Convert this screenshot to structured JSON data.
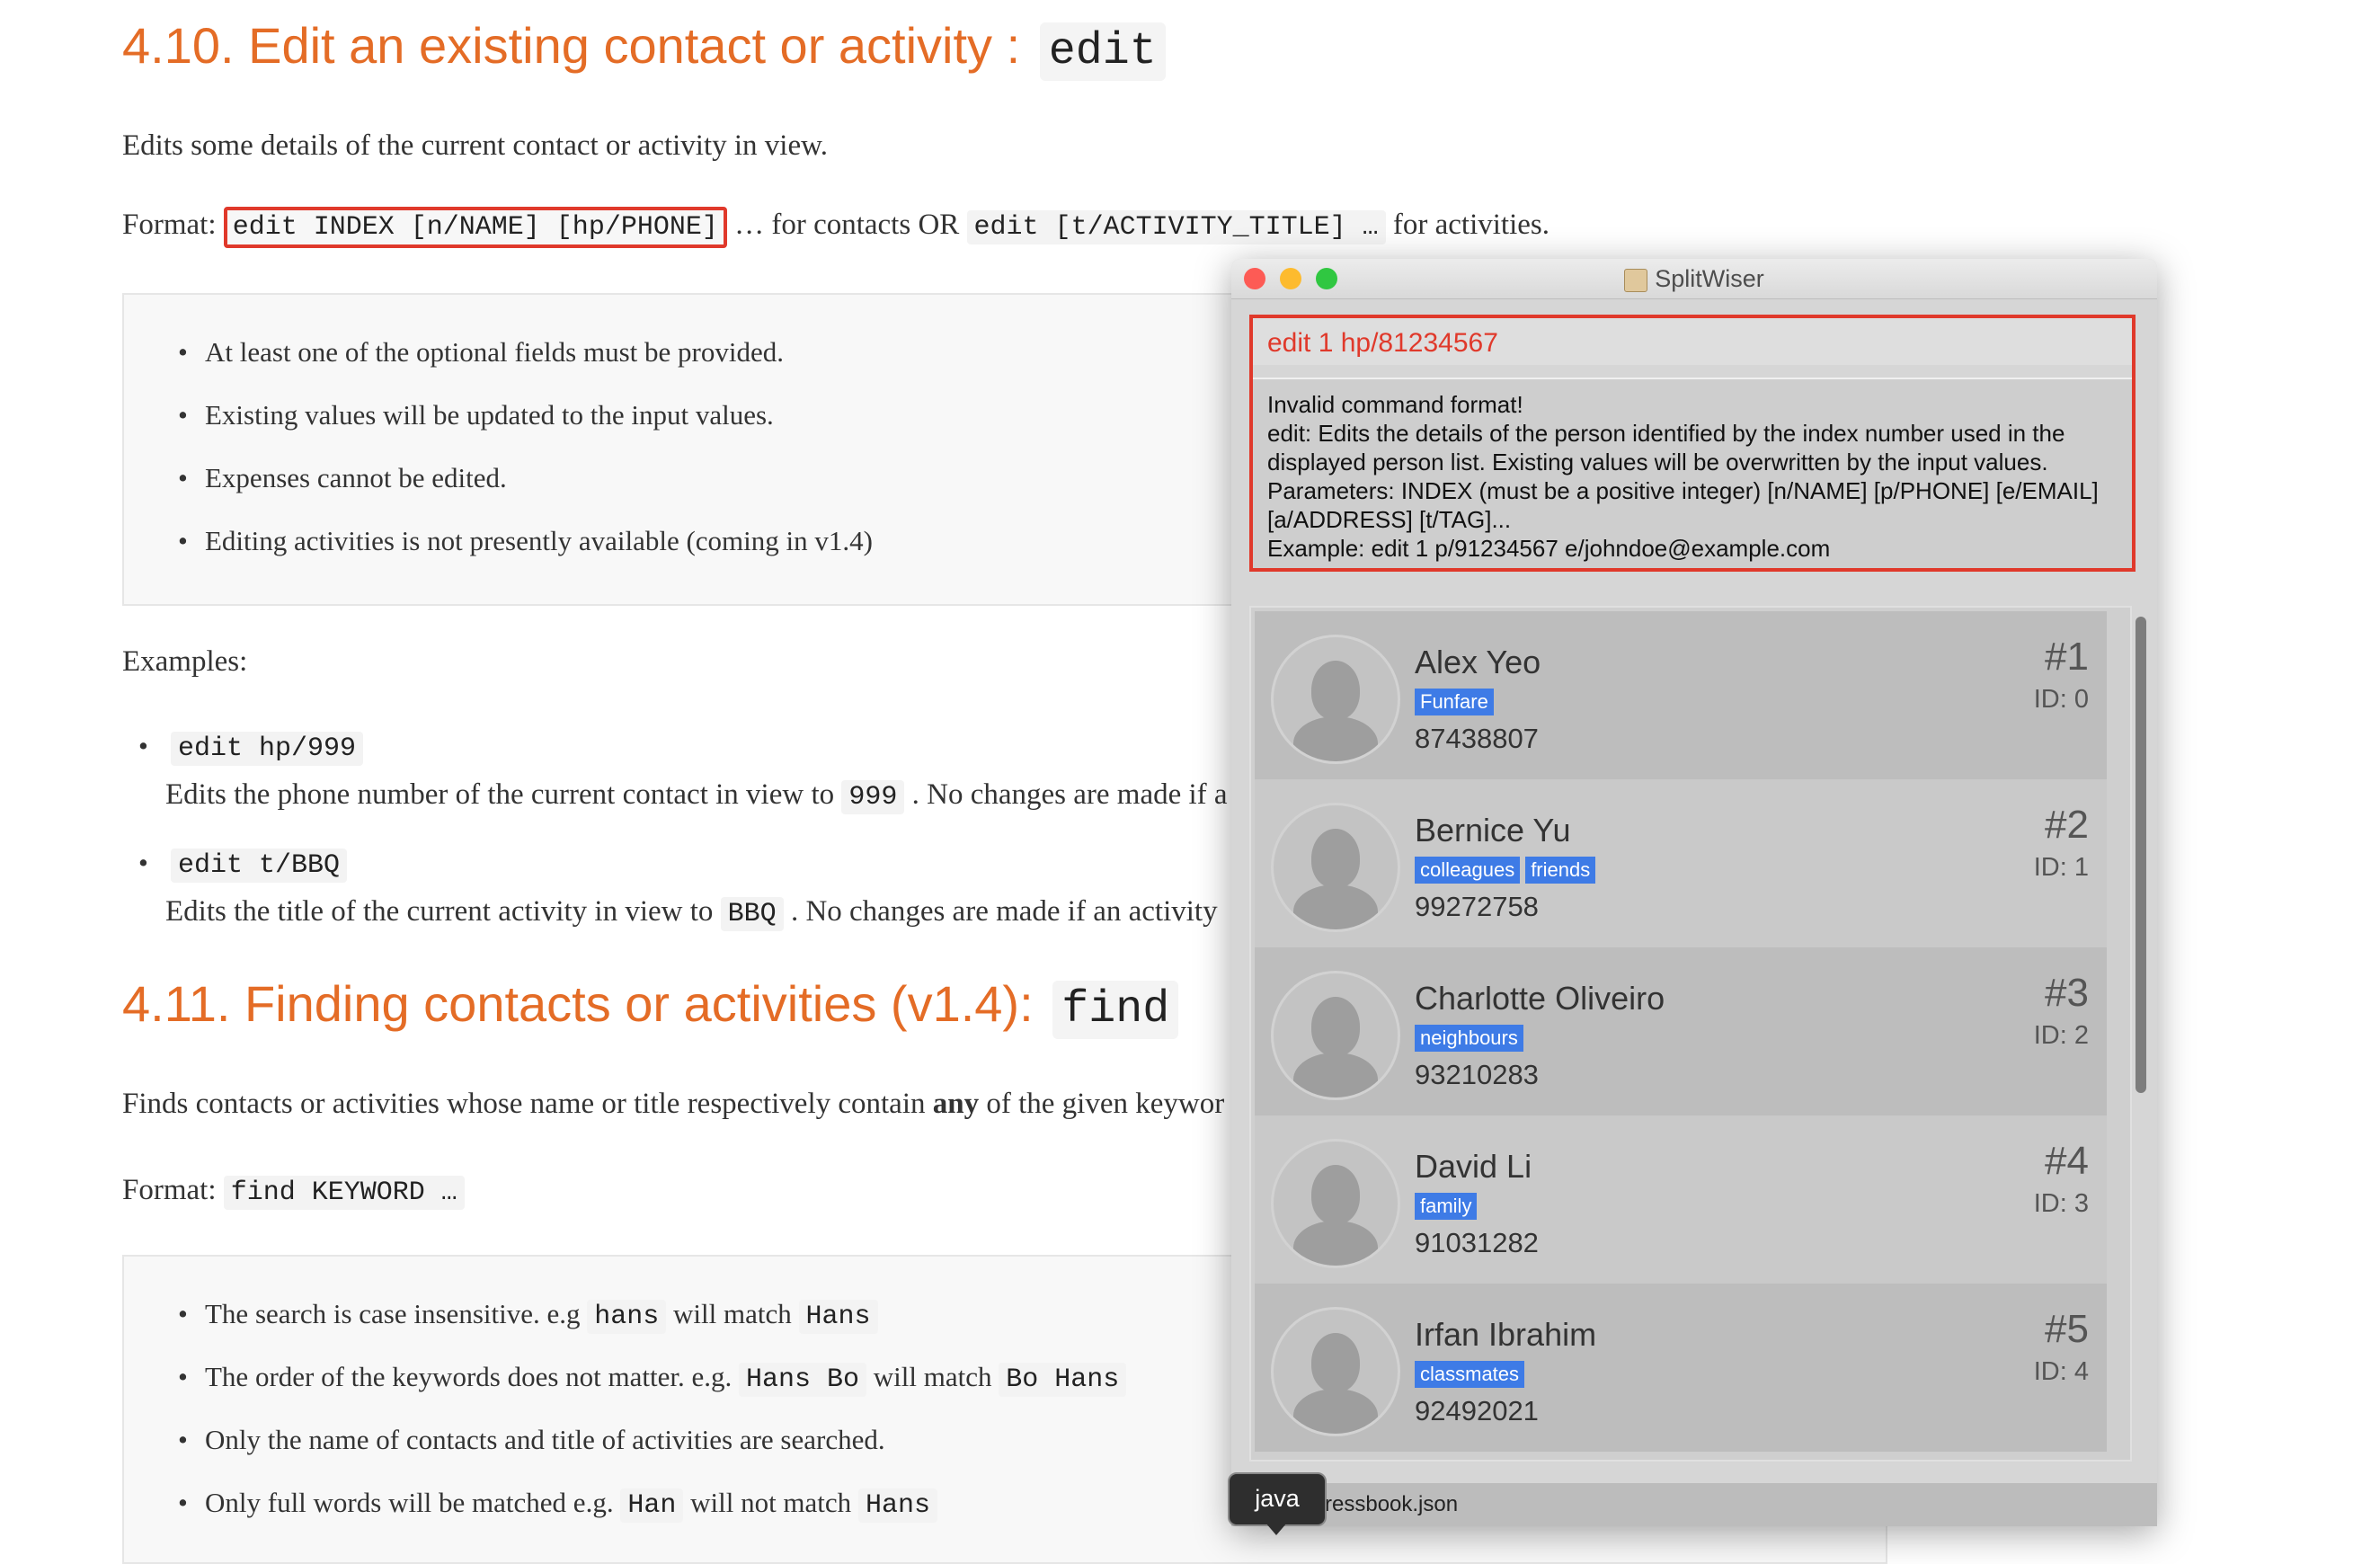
{
  "doc": {
    "s410_title": "4.10. Edit an existing contact or activity : ",
    "s410_code": "edit",
    "s410_desc": "Edits some details of the current contact or activity in view.",
    "format_label": "Format: ",
    "format_code1": "edit INDEX [n/NAME] [hp/PHONE]",
    "format_mid1": " … for contacts OR ",
    "format_code2": "edit [t/ACTIVITY_TITLE] …",
    "format_end": " for activities.",
    "notes": [
      "At least one of the optional fields must be provided.",
      "Existing values will be updated to the input values.",
      "Expenses cannot be edited.",
      "Editing activities is not presently available (coming in v1.4)"
    ],
    "examples_label": "Examples:",
    "ex1_code": "edit hp/999",
    "ex1_desc_a": "Edits the phone number of the current contact in view to ",
    "ex1_desc_code": "999",
    "ex1_desc_b": " . No changes are made if a",
    "ex2_code": "edit t/BBQ",
    "ex2_desc_a": "Edits the title of the current activity in view to ",
    "ex2_desc_code": "BBQ",
    "ex2_desc_b": " . No changes are made if an activity",
    "s411_title": "4.11. Finding contacts or activities (v1.4): ",
    "s411_code": "find",
    "s411_desc_a": "Finds contacts or activities whose name or title respectively contain ",
    "s411_desc_bold": "any",
    "s411_desc_b": " of the given keywor",
    "find_format_label": "Format: ",
    "find_format_code": "find KEYWORD …",
    "find_notes": [
      {
        "a": "The search is case insensitive. e.g ",
        "c1": "hans",
        "b": " will match ",
        "c2": "Hans"
      },
      {
        "a": "The order of the keywords does not matter. e.g. ",
        "c1": "Hans Bo",
        "b": " will match ",
        "c2": "Bo Hans"
      },
      {
        "a": "Only the name of contacts and title of activities are searched.",
        "c1": "",
        "b": "",
        "c2": ""
      },
      {
        "a": "Only full words will be matched e.g. ",
        "c1": "Han",
        "b": " will not match ",
        "c2": "Hans"
      }
    ]
  },
  "app": {
    "title": "SplitWiser",
    "command": "edit 1 hp/81234567",
    "result": "Invalid command format!\nedit: Edits the details of the person identified by the index number used in the\ndisplayed person list. Existing values will be overwritten by the input values.\nParameters: INDEX (must be a positive integer) [n/NAME] [p/PHONE] [e/EMAIL]\n[a/ADDRESS] [t/TAG]...\nExample: edit 1 p/91234567 e/johndoe@example.com",
    "persons": [
      {
        "name": "Alex Yeo",
        "tags": [
          "Funfare"
        ],
        "phone": "87438807",
        "num": "#1",
        "id": "ID: 0"
      },
      {
        "name": "Bernice Yu",
        "tags": [
          "colleagues",
          "friends"
        ],
        "phone": "99272758",
        "num": "#2",
        "id": "ID: 1"
      },
      {
        "name": "Charlotte Oliveiro",
        "tags": [
          "neighbours"
        ],
        "phone": "93210283",
        "num": "#3",
        "id": "ID: 2"
      },
      {
        "name": "David Li",
        "tags": [
          "family"
        ],
        "phone": "91031282",
        "num": "#4",
        "id": "ID: 3"
      },
      {
        "name": "Irfan Ibrahim",
        "tags": [
          "classmates"
        ],
        "phone": "92492021",
        "num": "#5",
        "id": "ID: 4"
      }
    ],
    "status": "ressbook.json",
    "tooltip": "java"
  }
}
